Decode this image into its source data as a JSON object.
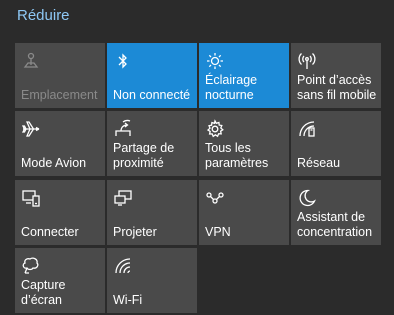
{
  "panel": {
    "collapse_label": "Réduire"
  },
  "colors": {
    "background": "#2b2b2b",
    "tile": "#4a4a4a",
    "tile_active": "#1c8ad6",
    "link": "#8ec8f5"
  },
  "tiles": [
    {
      "label": "Emplacement",
      "icon": "location-icon",
      "state": "disabled"
    },
    {
      "label": "Non connecté",
      "icon": "bluetooth-icon",
      "state": "active"
    },
    {
      "label": "Éclairage nocturne",
      "icon": "night-light-icon",
      "state": "active"
    },
    {
      "label": "Point d’accès sans fil mobile",
      "icon": "mobile-hotspot-icon",
      "state": "off"
    },
    {
      "label": "Mode Avion",
      "icon": "airplane-icon",
      "state": "off"
    },
    {
      "label": "Partage de proximité",
      "icon": "nearby-sharing-icon",
      "state": "off"
    },
    {
      "label": "Tous les paramètres",
      "icon": "gear-icon",
      "state": "off"
    },
    {
      "label": "Réseau",
      "icon": "network-icon",
      "state": "off"
    },
    {
      "label": "Connecter",
      "icon": "connect-icon",
      "state": "off"
    },
    {
      "label": "Projeter",
      "icon": "project-icon",
      "state": "off"
    },
    {
      "label": "VPN",
      "icon": "vpn-icon",
      "state": "off"
    },
    {
      "label": "Assistant de concentration",
      "icon": "focus-assist-moon-icon",
      "state": "off"
    },
    {
      "label": "Capture d’écran",
      "icon": "screen-snip-icon",
      "state": "off"
    },
    {
      "label": "Wi-Fi",
      "icon": "wifi-icon",
      "state": "off"
    }
  ]
}
